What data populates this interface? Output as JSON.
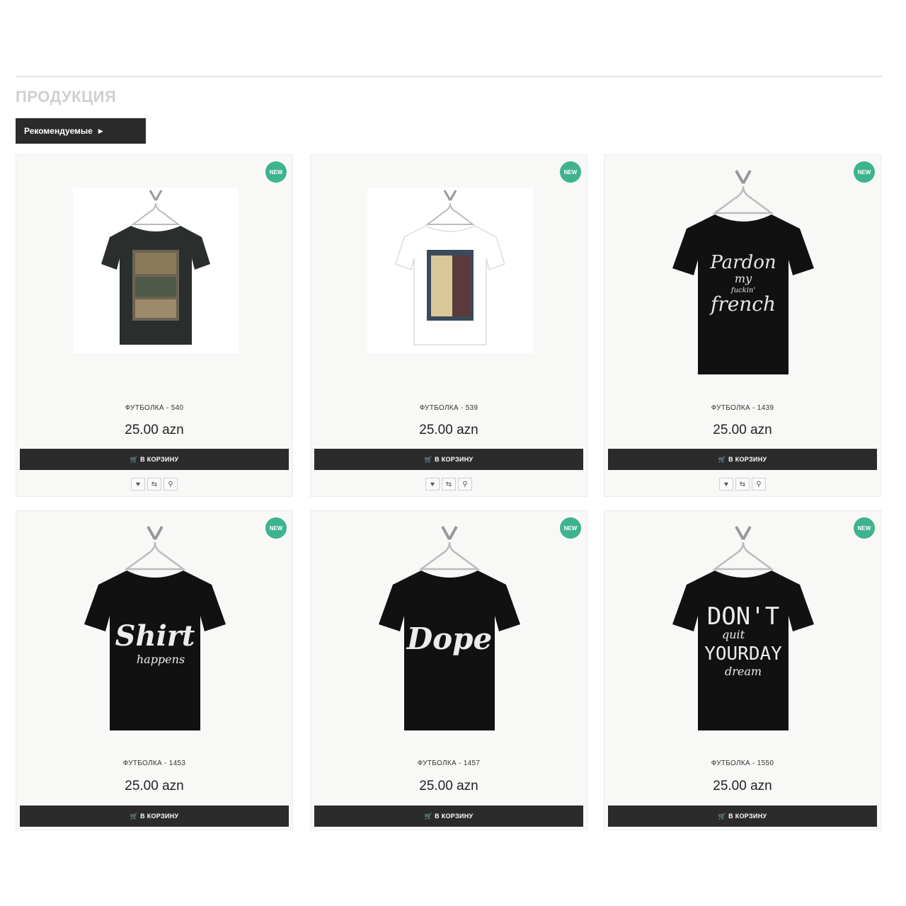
{
  "section": {
    "title": "ПРОДУКЦИЯ"
  },
  "sort": {
    "label": "Рекомендуемые"
  },
  "badge_label": "NEW",
  "cart_label": "В КОРЗИНУ",
  "colors": {
    "badge": "#3db38f",
    "button": "#2b2b2b",
    "card_bg": "#f8f8f6"
  },
  "products": [
    {
      "title": "ФУТБОЛКА - 540",
      "price": "25.00 azn",
      "shirt_color": "#2a2e2d",
      "print": "photo-collage"
    },
    {
      "title": "ФУТБОЛКА - 539",
      "price": "25.00 azn",
      "shirt_color": "#ffffff",
      "print": "photo-girl"
    },
    {
      "title": "ФУТБОЛКА - 1439",
      "price": "25.00 azn",
      "shirt_color": "#111111",
      "print": "Pardon my fuckin' french"
    },
    {
      "title": "ФУТБОЛКА - 1453",
      "price": "25.00 azn",
      "shirt_color": "#111111",
      "print": "Shirt happens"
    },
    {
      "title": "ФУТБОЛКА - 1457",
      "price": "25.00 azn",
      "shirt_color": "#111111",
      "print": "Dope"
    },
    {
      "title": "ФУТБОЛКА - 1550",
      "price": "25.00 azn",
      "shirt_color": "#111111",
      "print": "DON'T quit YOUR DAY dream"
    }
  ],
  "icons": {
    "wishlist": "heart-icon",
    "compare": "compare-icon",
    "quickview": "search-icon",
    "cart": "cart-icon"
  }
}
